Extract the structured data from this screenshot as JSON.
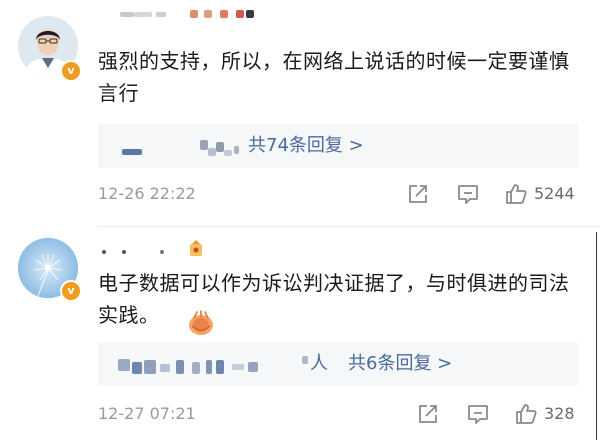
{
  "comments": [
    {
      "text": "强烈的支持，所以，在网络上说话的时候一定要谨慎言行",
      "reply_link": "共74条回复 >",
      "timestamp": "12-26 22:22",
      "likes": "5244"
    },
    {
      "text": "电子数据可以作为诉讼判决证据了，与时俱进的司法实践。",
      "reply_prefix": "人",
      "reply_link": "共6条回复 >",
      "timestamp": "12-27 07:21",
      "likes": "328"
    }
  ],
  "icons": {
    "repost": "share-icon",
    "comment": "comment-icon",
    "like": "thumbs-up-icon",
    "verified": "verified-badge-icon",
    "emoji": "clapping-hands-emoji-icon",
    "username_emoji": "decoration-icon"
  },
  "colors": {
    "link": "#4a6a9b",
    "timestamp": "#9a9a9a",
    "verified_badge": "#f29c1f",
    "reply_bg": "#f6f7f9"
  }
}
